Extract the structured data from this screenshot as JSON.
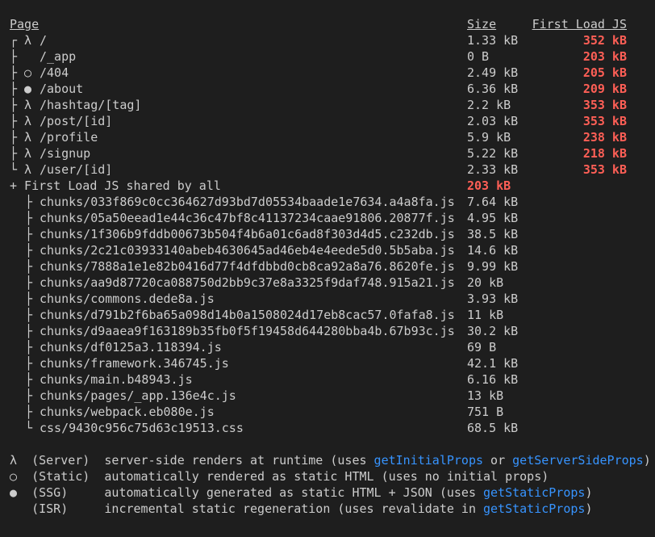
{
  "header": {
    "page": "Page",
    "size": "Size",
    "first_load": "First Load JS"
  },
  "routes": [
    {
      "tree": "┌ λ",
      "path": "/",
      "size": "1.33 kB",
      "first_load": "352 kB"
    },
    {
      "tree": "├  ",
      "path": "/_app",
      "size": "0 B",
      "first_load": "203 kB"
    },
    {
      "tree": "├ ○",
      "path": "/404",
      "size": "2.49 kB",
      "first_load": "205 kB"
    },
    {
      "tree": "├ ●",
      "path": "/about",
      "size": "6.36 kB",
      "first_load": "209 kB"
    },
    {
      "tree": "├ λ",
      "path": "/hashtag/[tag]",
      "size": "2.2 kB",
      "first_load": "353 kB"
    },
    {
      "tree": "├ λ",
      "path": "/post/[id]",
      "size": "2.03 kB",
      "first_load": "353 kB"
    },
    {
      "tree": "├ λ",
      "path": "/profile",
      "size": "5.9 kB",
      "first_load": "238 kB"
    },
    {
      "tree": "├ λ",
      "path": "/signup",
      "size": "5.22 kB",
      "first_load": "218 kB"
    },
    {
      "tree": "└ λ",
      "path": "/user/[id]",
      "size": "2.33 kB",
      "first_load": "353 kB"
    }
  ],
  "shared": {
    "label": "+ First Load JS shared by all",
    "value": "203 kB"
  },
  "chunks": [
    {
      "tree": "├",
      "name": "chunks/033f869c0cc364627d93bd7d05534baade1e7634.a4a8fa.js",
      "size": "7.64 kB"
    },
    {
      "tree": "├",
      "name": "chunks/05a50eead1e44c36c47bf8c41137234caae91806.20877f.js",
      "size": "4.95 kB"
    },
    {
      "tree": "├",
      "name": "chunks/1f306b9fddb00673b504f4b6a01c6ad8f303d4d5.c232db.js",
      "size": "38.5 kB"
    },
    {
      "tree": "├",
      "name": "chunks/2c21c03933140abeb4630645ad46eb4e4eede5d0.5b5aba.js",
      "size": "14.6 kB"
    },
    {
      "tree": "├",
      "name": "chunks/7888a1e1e82b0416d77f4dfdbbd0cb8ca92a8a76.8620fe.js",
      "size": "9.99 kB"
    },
    {
      "tree": "├",
      "name": "chunks/aa9d87720ca088750d2bb9c37e8a3325f9daf748.915a21.js",
      "size": "20 kB"
    },
    {
      "tree": "├",
      "name": "chunks/commons.dede8a.js",
      "size": "3.93 kB"
    },
    {
      "tree": "├",
      "name": "chunks/d791b2f6ba65a098d14b0a1508024d17eb8cac57.0fafa8.js",
      "size": "11 kB"
    },
    {
      "tree": "├",
      "name": "chunks/d9aaea9f163189b35fb0f5f19458d644280bba4b.67b93c.js",
      "size": "30.2 kB"
    },
    {
      "tree": "├",
      "name": "chunks/df0125a3.118394.js",
      "size": "69 B"
    },
    {
      "tree": "├",
      "name": "chunks/framework.346745.js",
      "size": "42.1 kB"
    },
    {
      "tree": "├",
      "name": "chunks/main.b48943.js",
      "size": "6.16 kB"
    },
    {
      "tree": "├",
      "name": "chunks/pages/_app.136e4c.js",
      "size": "13 kB"
    },
    {
      "tree": "├",
      "name": "chunks/webpack.eb080e.js",
      "size": "751 B"
    },
    {
      "tree": "└",
      "name": "css/9430c956c75d63c19513.css",
      "size": "68.5 kB"
    }
  ],
  "legend": [
    {
      "prefix": "λ  (Server)  server-side renders at runtime (uses ",
      "link1": "getInitialProps",
      "mid": " or ",
      "link2": "getServerSideProps",
      "suffix": ")"
    },
    {
      "prefix": "○  (Static)  automatically rendered as static HTML (uses no initial props)",
      "link1": "",
      "mid": "",
      "link2": "",
      "suffix": ""
    },
    {
      "prefix": "●  (SSG)     automatically generated as static HTML + JSON (uses ",
      "link1": "getStaticProps",
      "mid": "",
      "link2": "",
      "suffix": ")"
    },
    {
      "prefix": "   (ISR)     incremental static regeneration (uses revalidate in ",
      "link1": "getStaticProps",
      "mid": "",
      "link2": "",
      "suffix": ")"
    }
  ],
  "colors": {
    "background": "#1e1e1e",
    "text": "#cccccc",
    "first_load_red": "#ff5f56",
    "link_blue": "#3794ff"
  }
}
